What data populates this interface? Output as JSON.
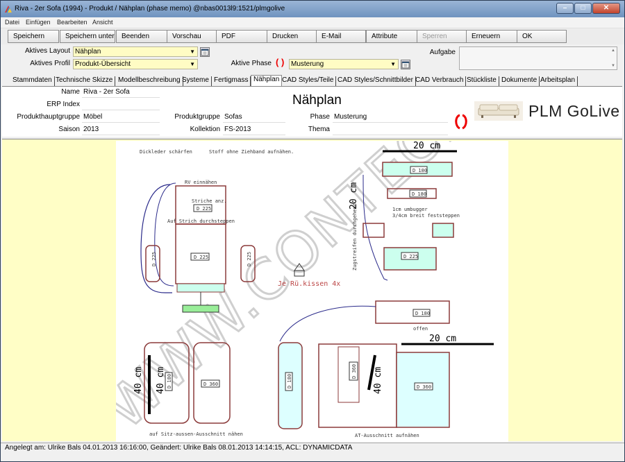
{
  "window": {
    "title": "Riva - 2er Sofa (1994) - Produkt / Nähplan (phase memo) @nbas0013l9:1521/plmgolive"
  },
  "menu": [
    "Datei",
    "Einfügen",
    "Bearbeiten",
    "Ansicht"
  ],
  "toolbar": [
    "Speichern",
    "Speichern unter",
    "Beenden",
    "Vorschau",
    "PDF",
    "Drucken",
    "E-Mail",
    "Attribute",
    "Sperren",
    "Erneuern",
    "OK"
  ],
  "layout": {
    "layout_label": "Aktives Layout",
    "layout_value": "Nähplan",
    "profil_label": "Aktives Profil",
    "profil_value": "Produkt-Übersicht",
    "phase_label": "Aktive Phase",
    "phase_value": "Musterung",
    "aufgabe_label": "Aufgabe",
    "aufgabe_value": ""
  },
  "tabs": [
    "Stammdaten",
    "Technische Skizze",
    "Modellbeschreibung",
    "Systeme",
    "Fertigmass",
    "Nähplan",
    "CAD Styles/Teile",
    "CAD Styles/Schnittbilder",
    "CAD Verbrauch",
    "Stückliste",
    "Dokumente",
    "Arbeitsplan"
  ],
  "header": {
    "name_label": "Name",
    "name": "Riva - 2er Sofa",
    "erp_label": "ERP Index",
    "erp": "",
    "phg_label": "Produkthauptgruppe",
    "phg": "Möbel",
    "saison_label": "Saison",
    "saison": "2013",
    "pg_label": "Produktgruppe",
    "pg": "Sofas",
    "koll_label": "Kollektion",
    "koll": "FS-2013",
    "phase_label": "Phase",
    "phase": "Musterung",
    "thema_label": "Thema",
    "thema": "",
    "title": "Nähplan",
    "brand": "PLM GoLive"
  },
  "drawing": {
    "note1": "Dickleder schärfen",
    "note2": "Stoff  ohne Ziehband aufnähen.",
    "rv": "RV einnähen",
    "striche": "Striche anz.",
    "d225a": "D 225",
    "aufstrich": "Auf Strich durchsteppen",
    "d225b": "D 225",
    "d225c": "D 225",
    "d225d": "D 225",
    "d225e": "D 225",
    "cm20a": "20  cm",
    "d180a": "D 180",
    "d180b": "D 180",
    "umbugger": "1cm umbugger",
    "breit": "3/4cm breit feststeppen",
    "zugstreifen": "Zugstreifen durchgehend",
    "cm20v": "20 cm",
    "ruckissen": "Je Rü.kissen  4x",
    "d180c": "D 180",
    "offen": "offen",
    "cm20b": "20  cm",
    "cm40a": "40 cm",
    "cm40b": "40 cm",
    "d180d": "D 180",
    "d360a": "D 360",
    "sitz": "auf  Sitz-aussen-Ausschnitt nähen",
    "d180e": "D 180",
    "d360b": "D 360",
    "cm40c": "40 cm",
    "d360c": "D 360",
    "at": "AT-Ausschnitt aufnähen",
    "watermark": "WWW.CONTEC.PL"
  },
  "status": "Angelegt am: Ulrike Bals 04.01.2013 16:16:00, Geändert: Ulrike Bals 08.01.2013 14:14:15, ACL: DYNAMICDATA",
  "colors": {
    "field": "#fffcc4",
    "content_bg": "#fffec6",
    "refresh": "#e00000"
  }
}
